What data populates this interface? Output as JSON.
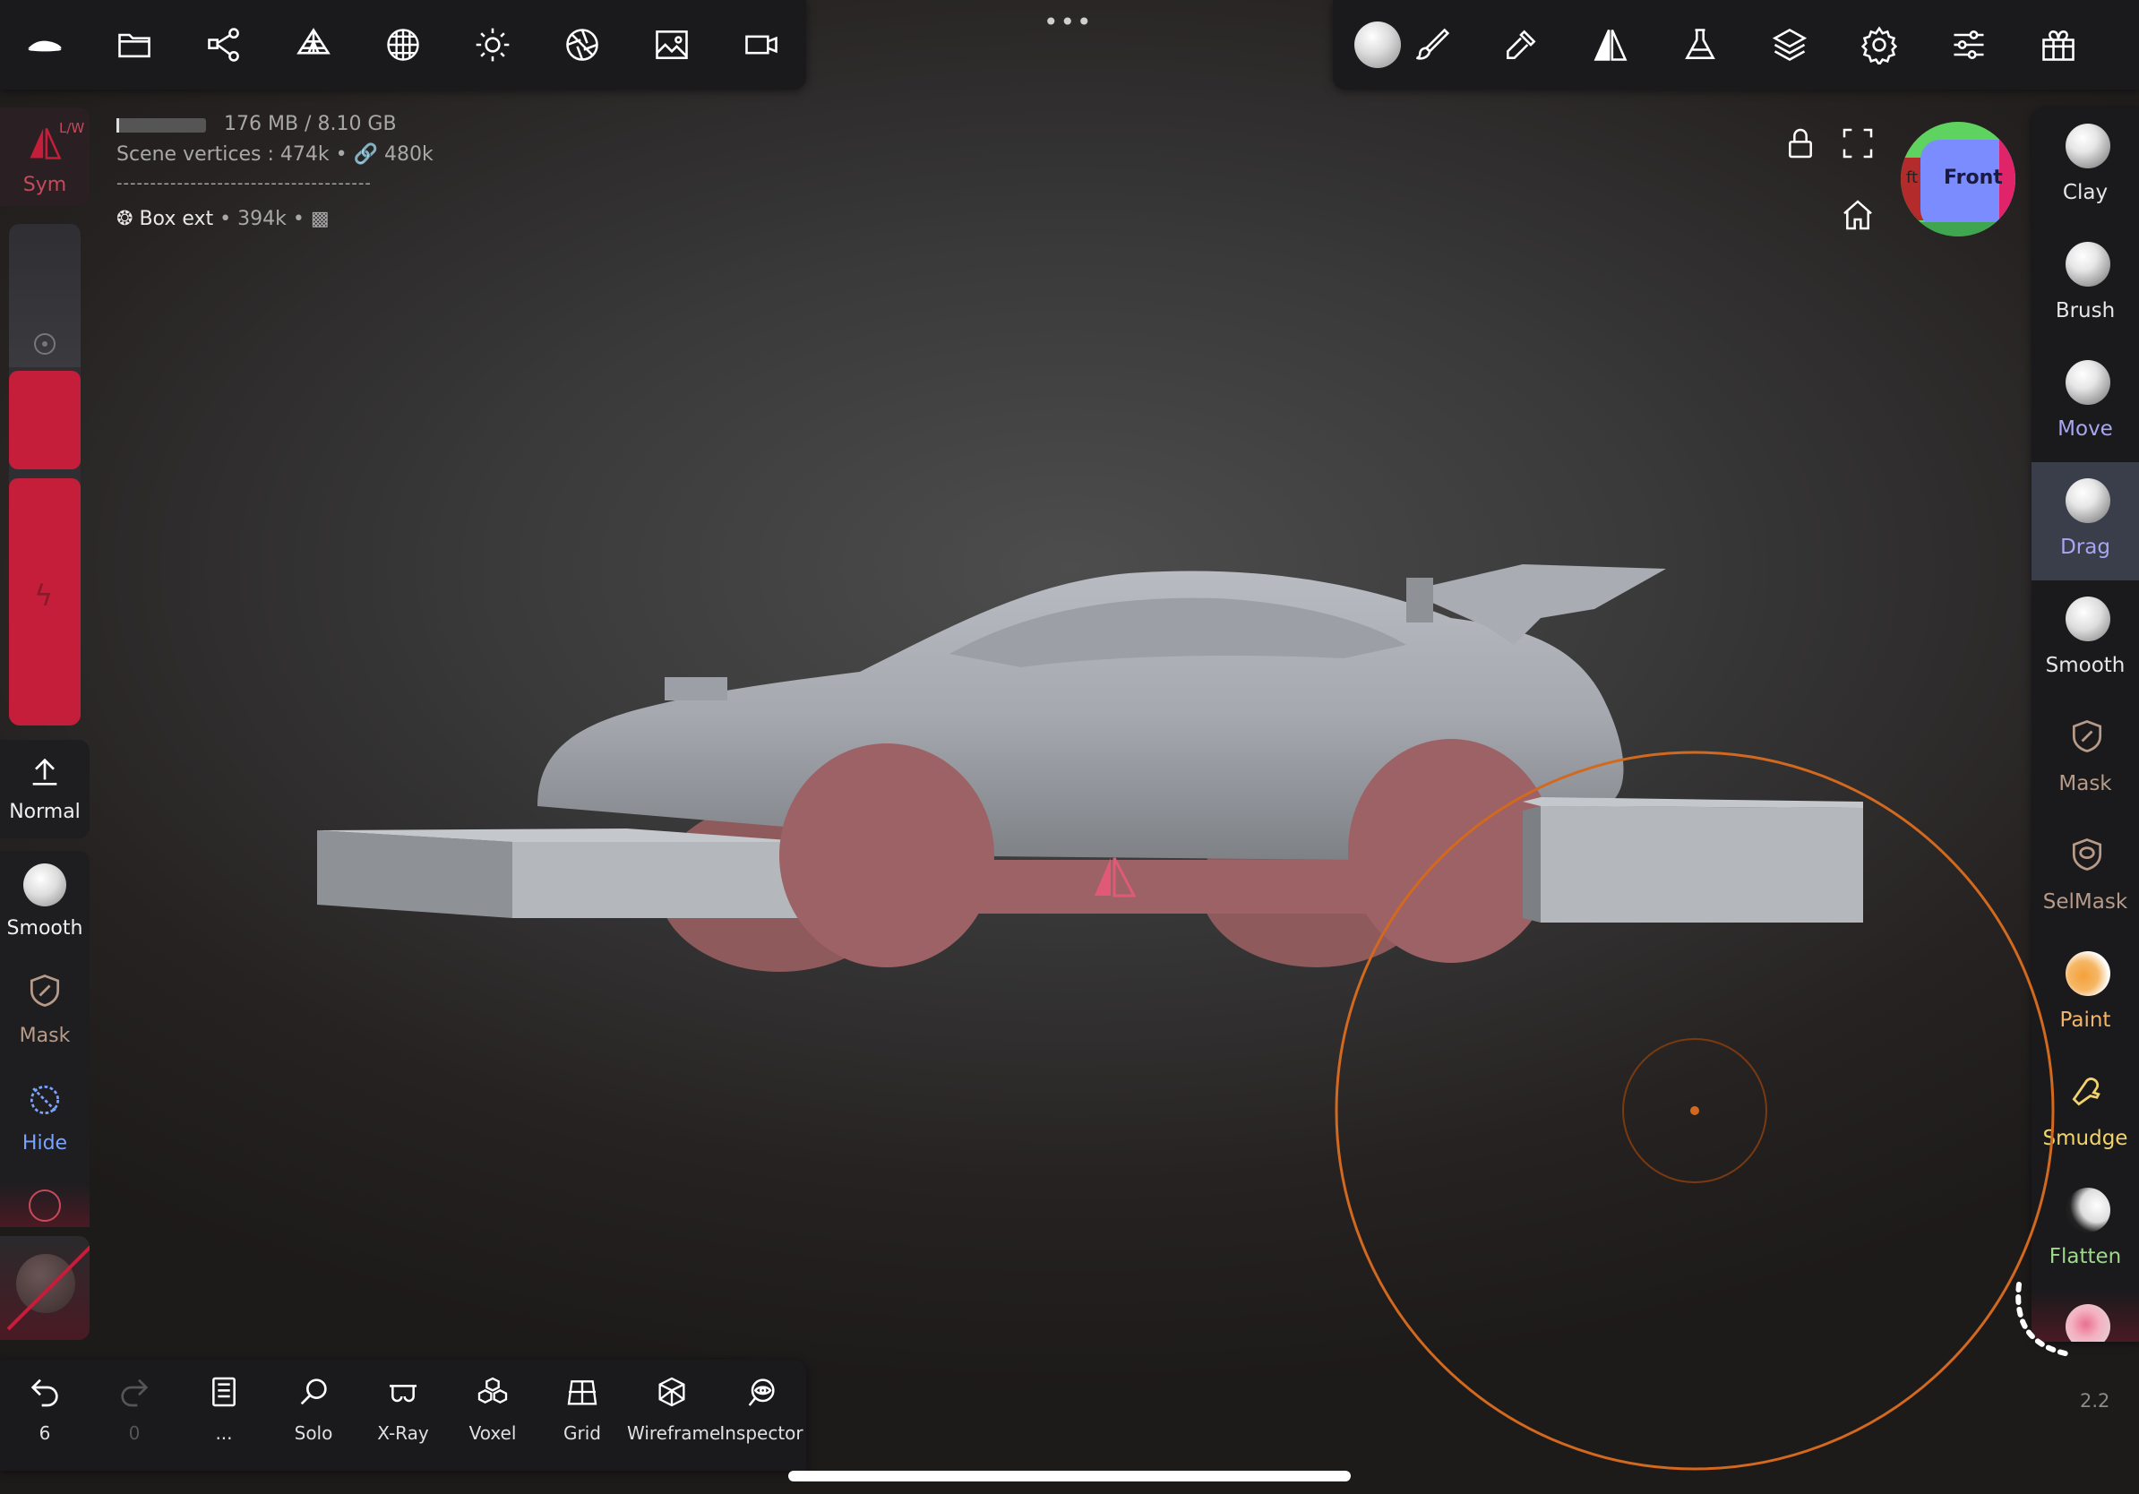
{
  "info": {
    "memory": "176 MB / 8.10 GB",
    "vertices_label": "Scene vertices :",
    "vertices_value": "474k",
    "vertices_linked": "480k",
    "separator": "--------------------------------------",
    "object_name": "Box ext",
    "object_count": "394k"
  },
  "left_sidebar": {
    "sym_label": "Sym",
    "sym_badge": "L/W",
    "normal_label": "Normal",
    "smooth_label": "Smooth",
    "mask_label": "Mask",
    "hide_label": "Hide"
  },
  "right_sidebar": {
    "tools": [
      {
        "label": "Clay",
        "color": "#e6e6e6"
      },
      {
        "label": "Brush",
        "color": "#e6e6e6"
      },
      {
        "label": "Move",
        "color": "#a8a6f0"
      },
      {
        "label": "Drag",
        "color": "#a8a6f0"
      },
      {
        "label": "Smooth",
        "color": "#e6e6e6"
      },
      {
        "label": "Mask",
        "color": "#b79a88"
      },
      {
        "label": "SelMask",
        "color": "#b79a88"
      },
      {
        "label": "Paint",
        "color": "#f2b56b"
      },
      {
        "label": "Smudge",
        "color": "#f2d46b"
      },
      {
        "label": "Flatten",
        "color": "#9fd88a"
      }
    ],
    "active_tool": "Drag"
  },
  "viewcube": {
    "front_label": "Front",
    "left_label": "ft"
  },
  "bottom_toolbar": {
    "undo_count": "6",
    "redo_count": "0",
    "more_label": "...",
    "solo": "Solo",
    "xray": "X-Ray",
    "voxel": "Voxel",
    "grid": "Grid",
    "wireframe": "Wireframe",
    "inspector": "Inspector"
  },
  "top_center_menu": "•••",
  "zoom_value": "2.2",
  "colors": {
    "accent_red": "#c41e3a",
    "brush_orange": "#d2691e",
    "panel_bg": "#1a1a1c"
  }
}
